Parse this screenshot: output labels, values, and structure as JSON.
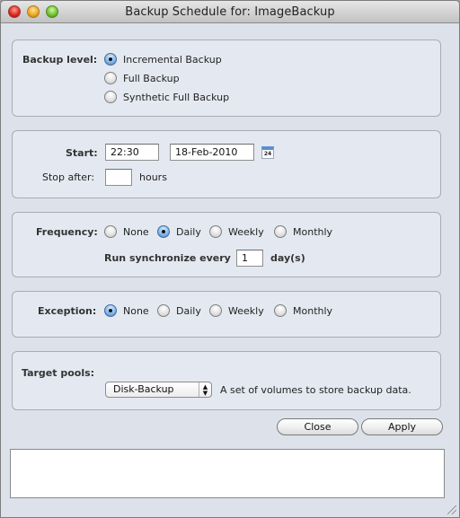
{
  "window": {
    "title": "Backup Schedule for: ImageBackup"
  },
  "backup_level": {
    "label": "Backup level:",
    "options": [
      {
        "label": "Incremental Backup",
        "selected": true
      },
      {
        "label": "Full Backup",
        "selected": false
      },
      {
        "label": "Synthetic Full Backup",
        "selected": false
      }
    ]
  },
  "start": {
    "label": "Start:",
    "time_value": "22:30",
    "date_value": "18-Feb-2010",
    "calendar_icon_text": "24",
    "stop_after_label": "Stop after:",
    "stop_after_value": "",
    "hours_label": "hours"
  },
  "frequency": {
    "label": "Frequency:",
    "options": [
      {
        "label": "None",
        "selected": false
      },
      {
        "label": "Daily",
        "selected": true
      },
      {
        "label": "Weekly",
        "selected": false
      },
      {
        "label": "Monthly",
        "selected": false
      }
    ],
    "sync_label": "Run synchronize every",
    "sync_value": "1",
    "sync_unit": "day(s)"
  },
  "exception": {
    "label": "Exception:",
    "options": [
      {
        "label": "None",
        "selected": true
      },
      {
        "label": "Daily",
        "selected": false
      },
      {
        "label": "Weekly",
        "selected": false
      },
      {
        "label": "Monthly",
        "selected": false
      }
    ]
  },
  "target_pools": {
    "label": "Target pools:",
    "selected": "Disk-Backup",
    "description": "A set of volumes to store backup data."
  },
  "buttons": {
    "close": "Close",
    "apply": "Apply"
  },
  "log": {
    "text": ""
  }
}
